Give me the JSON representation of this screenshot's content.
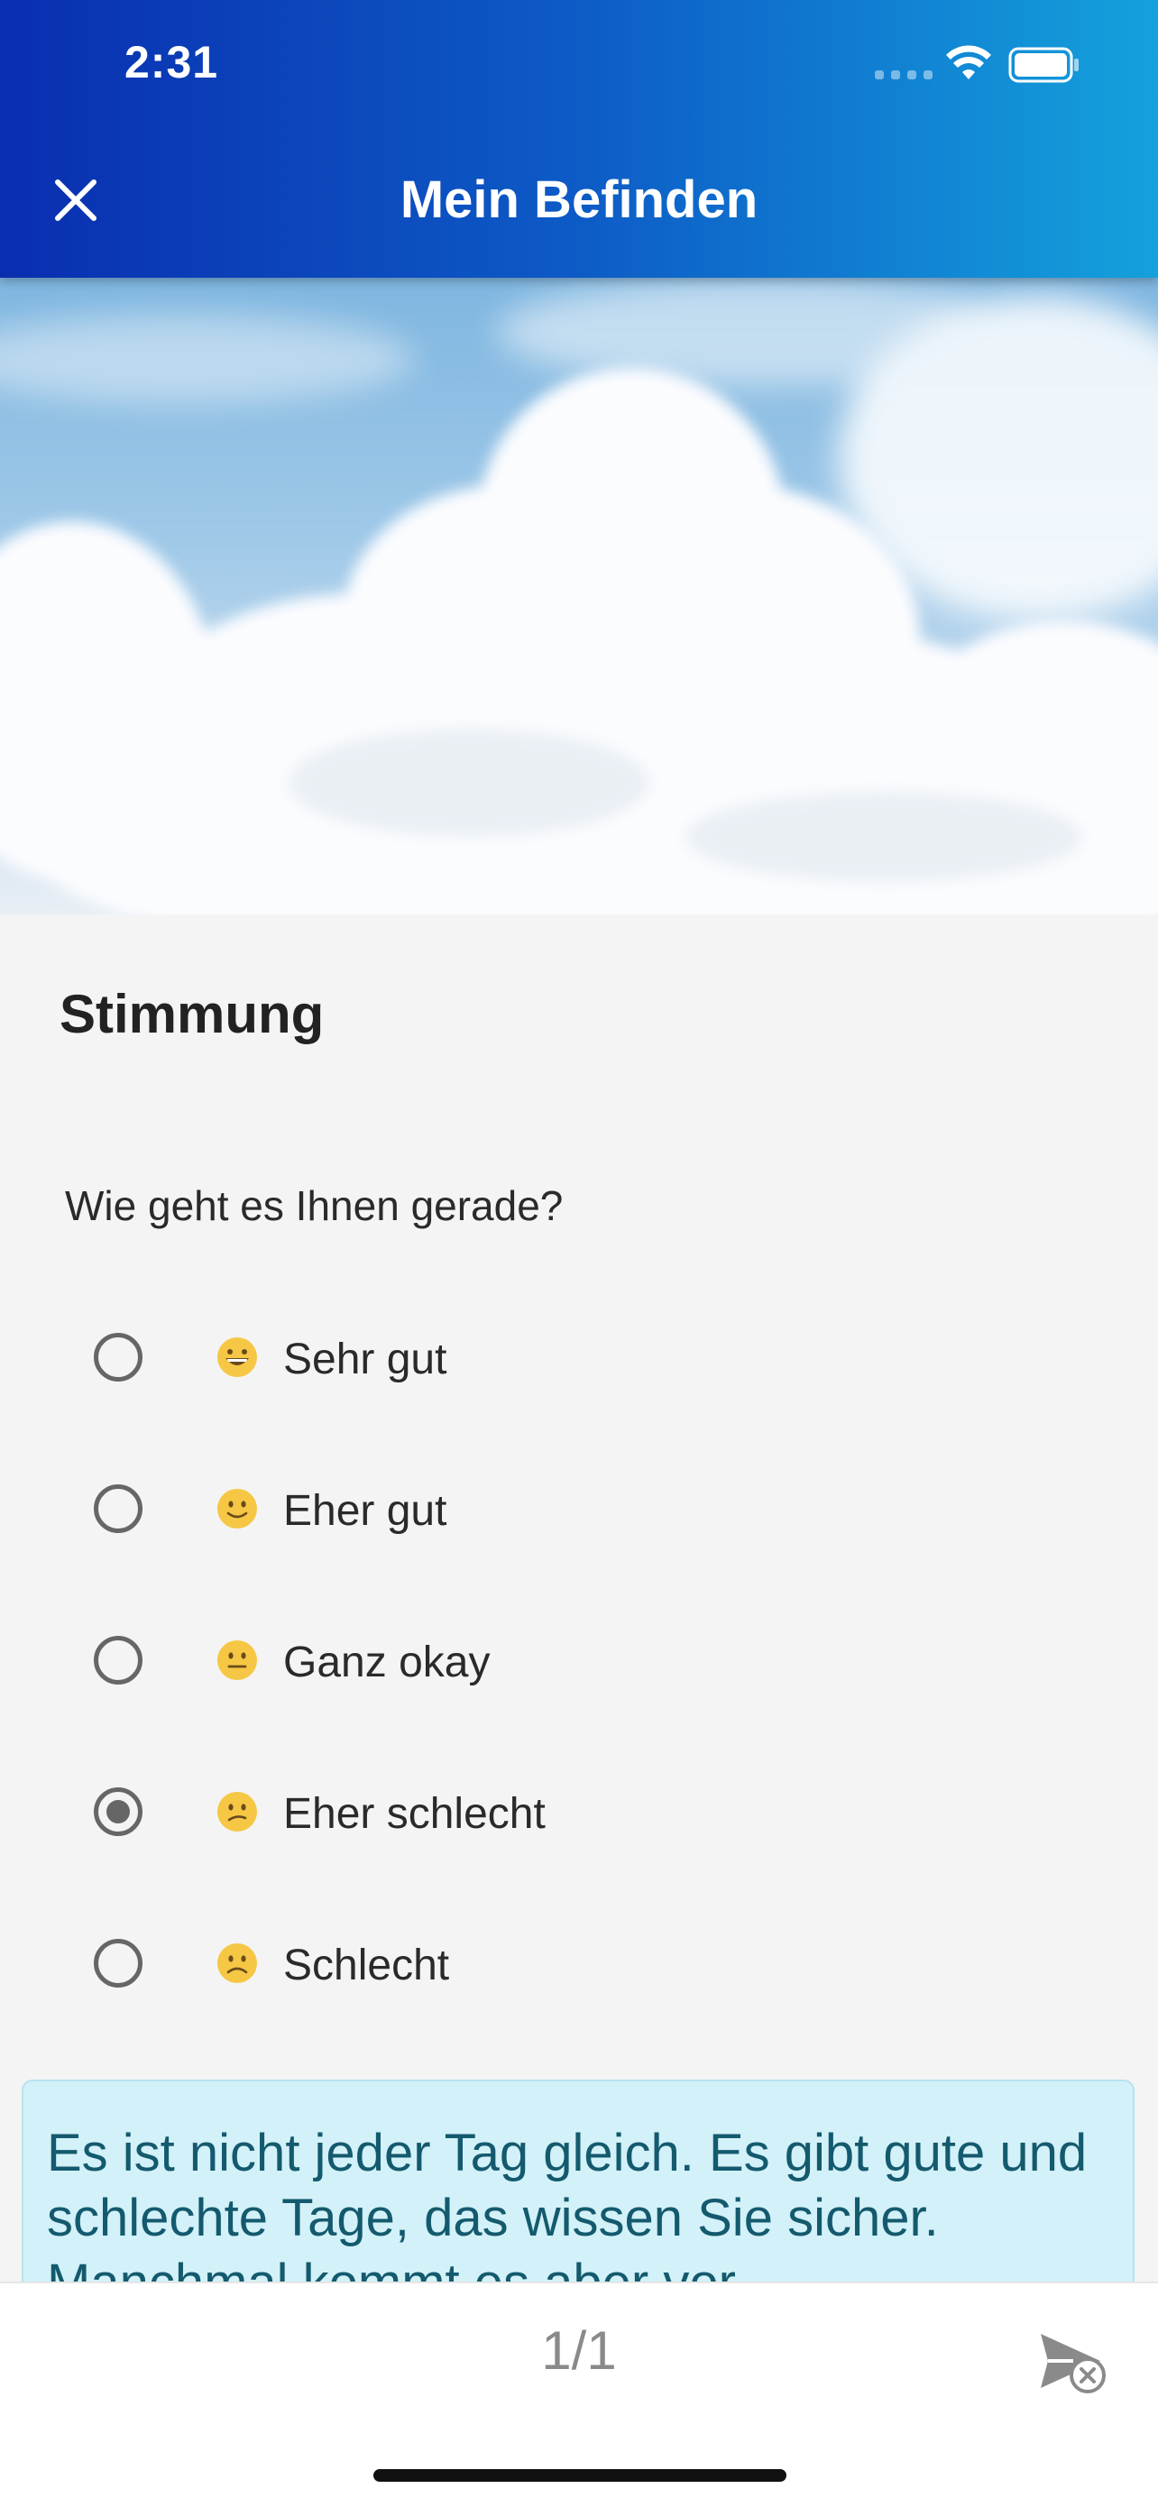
{
  "status_bar": {
    "time": "2:31"
  },
  "app_bar": {
    "title": "Mein Befinden",
    "close_icon": "close-icon"
  },
  "section": {
    "title": "Stimmung"
  },
  "question": {
    "text": "Wie geht es Ihnen gerade?"
  },
  "options": [
    {
      "label": "Sehr gut",
      "emoji": "grinning-face-icon",
      "selected": false
    },
    {
      "label": "Eher gut",
      "emoji": "slightly-smiling-face-icon",
      "selected": false
    },
    {
      "label": "Ganz okay",
      "emoji": "neutral-face-icon",
      "selected": false
    },
    {
      "label": "Eher schlecht",
      "emoji": "confused-face-icon",
      "selected": true
    },
    {
      "label": "Schlecht",
      "emoji": "slightly-frowning-face-icon",
      "selected": false
    }
  ],
  "info_card": {
    "text": "Es ist nicht jeder Tag gleich. Es gibt gute und schlechte Tage, das wissen Sie sicher. Manchmal kommt es aber vor"
  },
  "bottom_bar": {
    "page_indicator": "1/1",
    "send_icon": "send-disabled-icon"
  },
  "colors": {
    "header_gradient_start": "#0a2eb0",
    "header_gradient_end": "#14a1dc",
    "info_card_bg": "#d3f1f8",
    "info_card_text": "#145a6e"
  }
}
